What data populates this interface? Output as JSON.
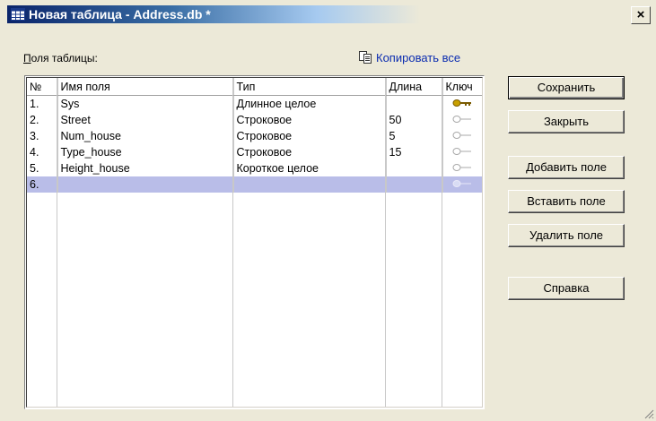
{
  "window": {
    "title": "Новая таблица - Address.db *",
    "close_label": "×"
  },
  "fields_label": {
    "accel": "П",
    "rest": "оля таблицы:"
  },
  "copy_all_label": "Копировать все",
  "table": {
    "headers": [
      "№",
      "Имя поля",
      "Тип",
      "Длина",
      "Ключ"
    ],
    "rows": [
      {
        "num": "1.",
        "name": "Sys",
        "type": "Длинное целое",
        "length": "",
        "key": "primary"
      },
      {
        "num": "2.",
        "name": "Street",
        "type": "Строковое",
        "length": "50",
        "key": "none"
      },
      {
        "num": "3.",
        "name": "Num_house",
        "type": "Строковое",
        "length": "5",
        "key": "none"
      },
      {
        "num": "4.",
        "name": "Type_house",
        "type": "Строковое",
        "length": "15",
        "key": "none"
      },
      {
        "num": "5.",
        "name": "Height_house",
        "type": "Короткое целое",
        "length": "",
        "key": "none"
      },
      {
        "num": "6.",
        "name": "",
        "type": "",
        "length": "",
        "key": "none"
      }
    ],
    "selected_row_index": 5
  },
  "buttons": {
    "save": "Сохранить",
    "close": "Закрыть",
    "add_field": "Добавить поле",
    "insert_field": "Вставить поле",
    "delete_field": "Удалить поле",
    "help": "Справка"
  },
  "colors": {
    "selection": "#b9bde8",
    "key_active": "#c8a000",
    "link": "#0b2cb0"
  }
}
